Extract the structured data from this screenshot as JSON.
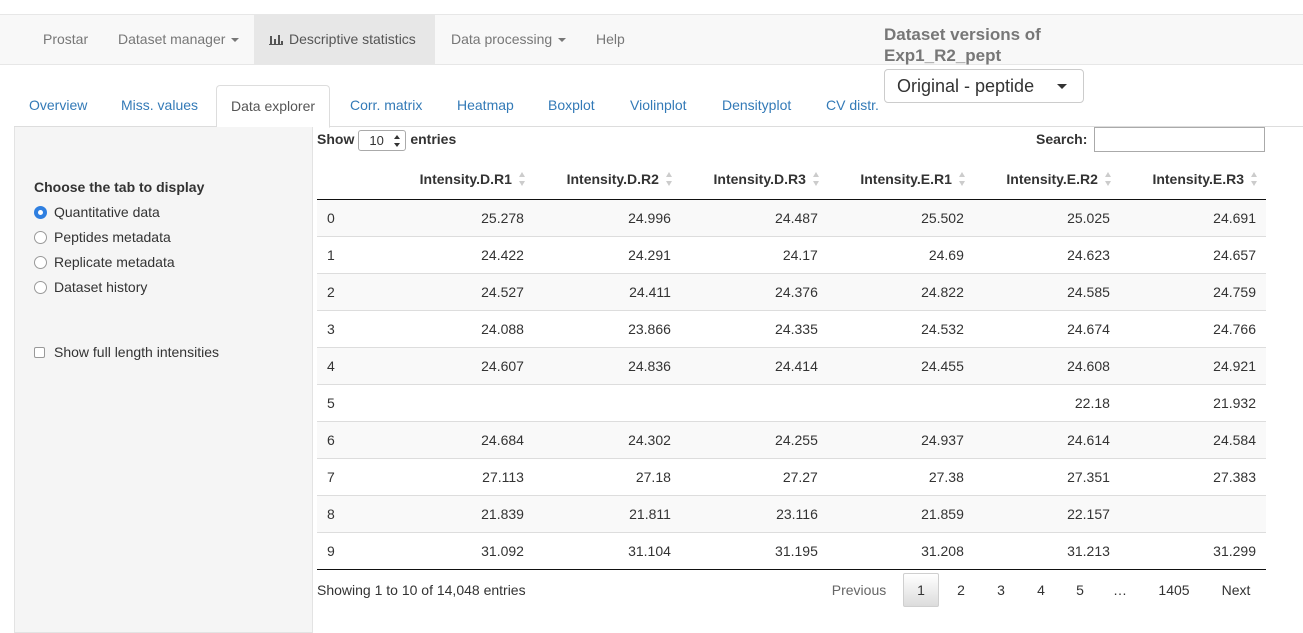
{
  "navbar": {
    "brand": "Prostar",
    "items": [
      {
        "label": "Dataset manager"
      },
      {
        "label": "Descriptive statistics"
      },
      {
        "label": "Data processing"
      },
      {
        "label": "Help"
      }
    ]
  },
  "versions": {
    "title": "Dataset versions of Exp1_R2_pept",
    "selected": "Original - peptide"
  },
  "tabs": [
    "Overview",
    "Miss. values",
    "Data explorer",
    "Corr. matrix",
    "Heatmap",
    "Boxplot",
    "Violinplot",
    "Densityplot",
    "CV distr."
  ],
  "active_tab": "Data explorer",
  "sidebar": {
    "label": "Choose the tab to display",
    "options": [
      "Quantitative data",
      "Peptides metadata",
      "Replicate metadata",
      "Dataset history"
    ],
    "selected": "Quantitative data",
    "checkbox_label": "Show full length intensities"
  },
  "table_controls": {
    "show": "Show",
    "entries_value": "10",
    "entries": "entries",
    "search_label": "Search:",
    "search_value": ""
  },
  "table": {
    "columns": [
      "",
      "Intensity.D.R1",
      "Intensity.D.R2",
      "Intensity.D.R3",
      "Intensity.E.R1",
      "Intensity.E.R2",
      "Intensity.E.R3"
    ],
    "rows": [
      [
        "0",
        "25.278",
        "24.996",
        "24.487",
        "25.502",
        "25.025",
        "24.691"
      ],
      [
        "1",
        "24.422",
        "24.291",
        "24.17",
        "24.69",
        "24.623",
        "24.657"
      ],
      [
        "2",
        "24.527",
        "24.411",
        "24.376",
        "24.822",
        "24.585",
        "24.759"
      ],
      [
        "3",
        "24.088",
        "23.866",
        "24.335",
        "24.532",
        "24.674",
        "24.766"
      ],
      [
        "4",
        "24.607",
        "24.836",
        "24.414",
        "24.455",
        "24.608",
        "24.921"
      ],
      [
        "5",
        "",
        "",
        "",
        "",
        "22.18",
        "21.932"
      ],
      [
        "6",
        "24.684",
        "24.302",
        "24.255",
        "24.937",
        "24.614",
        "24.584"
      ],
      [
        "7",
        "27.113",
        "27.18",
        "27.27",
        "27.38",
        "27.351",
        "27.383"
      ],
      [
        "8",
        "21.839",
        "21.811",
        "23.116",
        "21.859",
        "22.157",
        ""
      ],
      [
        "9",
        "31.092",
        "31.104",
        "31.195",
        "31.208",
        "31.213",
        "31.299"
      ]
    ]
  },
  "footer": {
    "info": "Showing 1 to 10 of 14,048 entries",
    "previous": "Previous",
    "pages": [
      "1",
      "2",
      "3",
      "4",
      "5",
      "…",
      "1405"
    ],
    "current_page": "1",
    "next": "Next"
  },
  "colors": {
    "link": "#337ab7",
    "radio_selected": "#2f7fe0",
    "navbar_bg": "#f8f8f8",
    "sidebar_bg": "#f5f5f5"
  }
}
